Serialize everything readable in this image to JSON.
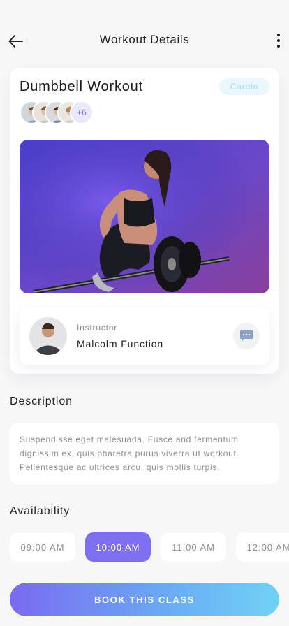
{
  "header": {
    "title": "Workout Details",
    "back_icon": "arrow-left-icon",
    "more_icon": "more-vertical-icon"
  },
  "workout": {
    "title": "Dumbbell Workout",
    "tag": "Cardio",
    "participants_more": "+6"
  },
  "instructor": {
    "role": "Instructor",
    "name": "Malcolm Function",
    "chat_icon": "chat-bubble-icon"
  },
  "description": {
    "title": "Description",
    "text": "Suspendisse eget malesuada. Fusce and fermentum dignissim ex, quis pharetra purus viverra ut workout. Pellentesque ac ultrices arcu, quis mollis turpis."
  },
  "availability": {
    "title": "Availability",
    "slots": [
      "09:00 AM",
      "10:00 AM",
      "11:00 AM",
      "12:00 AM"
    ],
    "selected": "10:00 AM"
  },
  "cta": {
    "label": "BOOK THIS CLASS"
  },
  "colors": {
    "accent": "#7d6ff0",
    "tag_bg": "#eaf8fd",
    "tag_text": "#9fd8ef",
    "gradient_start": "#7a6af1",
    "gradient_end": "#6fd2f5"
  }
}
